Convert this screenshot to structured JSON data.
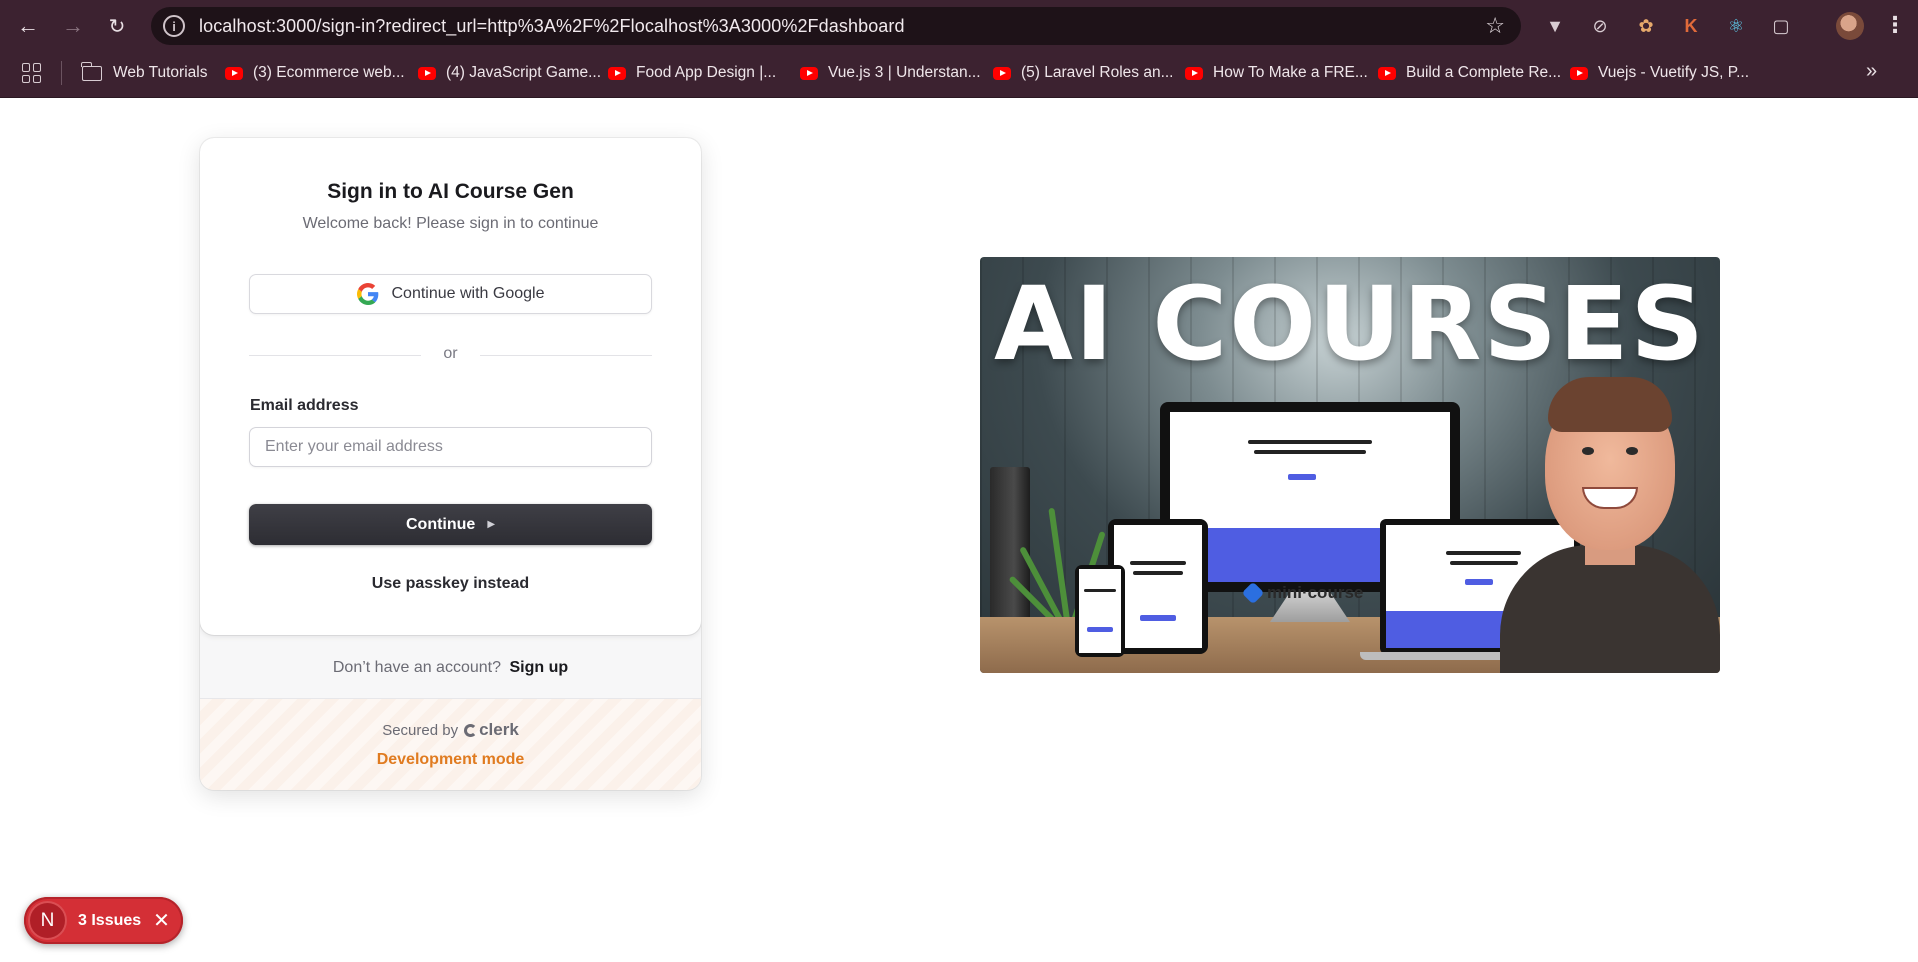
{
  "browser": {
    "url": "localhost:3000/sign-in?redirect_url=http%3A%2F%2Flocalhost%3A3000%2Fdashboard",
    "bookmarks": [
      {
        "label": "Web Tutorials",
        "icon": "folder-icon"
      },
      {
        "label": "(3) Ecommerce web...",
        "icon": "youtube-icon"
      },
      {
        "label": "(4) JavaScript Game...",
        "icon": "youtube-icon"
      },
      {
        "label": "Food App Design |...",
        "icon": "youtube-icon"
      },
      {
        "label": "Vue.js 3 | Understan...",
        "icon": "youtube-icon"
      },
      {
        "label": "(5) Laravel Roles an...",
        "icon": "youtube-icon"
      },
      {
        "label": "How To Make a FRE...",
        "icon": "youtube-icon"
      },
      {
        "label": "Build a Complete Re...",
        "icon": "youtube-icon"
      },
      {
        "label": "Vuejs - Vuetify JS, P...",
        "icon": "youtube-icon"
      }
    ]
  },
  "signin": {
    "title": "Sign in to AI Course Gen",
    "subtitle": "Welcome back! Please sign in to continue",
    "google_label": "Continue with Google",
    "divider_text": "or",
    "email_label": "Email address",
    "email_placeholder": "Enter your email address",
    "email_value": "",
    "continue_label": "Continue",
    "passkey_label": "Use passkey instead",
    "signup_prompt": "Don’t have an account?",
    "signup_link": "Sign up",
    "secured_by": "Secured by",
    "clerk_brand": "clerk",
    "dev_mode": "Development mode"
  },
  "hero": {
    "title": "AI COURSES",
    "product_name": "mini·course"
  },
  "issues_badge": {
    "avatar_letter": "N",
    "label": "3 Issues"
  },
  "colors": {
    "browser_chrome": "#3c2230",
    "accent_dev": "#e07b20",
    "issues_red": "#d42f36",
    "button_dark": "#2d2d33"
  }
}
